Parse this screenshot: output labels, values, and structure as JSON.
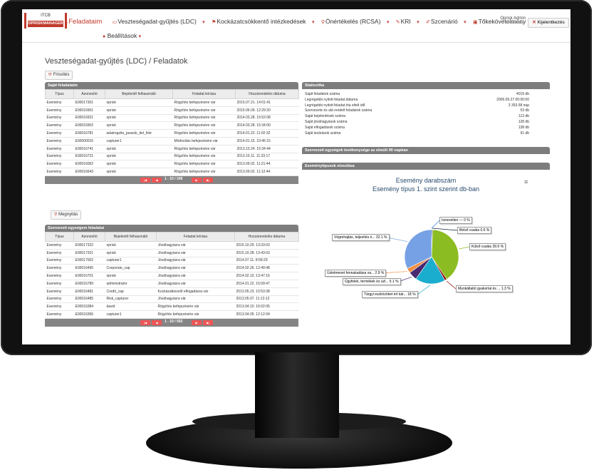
{
  "app": {
    "logo_line1": "ITCB",
    "logo_line2": "OPRISKMANAGER"
  },
  "nav": {
    "items": [
      {
        "label": "Feladataim",
        "icon": "home-icon",
        "active": true
      },
      {
        "label": "Veszteségadat-gyűjtés (LDC)",
        "icon": "folder-icon"
      },
      {
        "label": "Kockázatcsökkentő intézkedések",
        "icon": "flag-icon"
      },
      {
        "label": "Önértékelés (RCSA)",
        "icon": "marker-icon"
      },
      {
        "label": "KRI",
        "icon": "wrench-icon"
      },
      {
        "label": "Szcenárió",
        "icon": "pencil-icon"
      },
      {
        "label": "Tőkekövetelmény",
        "icon": "lock-icon"
      }
    ],
    "settings_label": "Beállítások"
  },
  "user": {
    "name": "Oprisk Admin",
    "role": "Adminisztrátor",
    "logout_label": "Kijelentkezés"
  },
  "page": {
    "title": "Veszteségadat-gyűjtés (LDC) / Feladatok",
    "refresh_label": "Frissítés",
    "open_label": "Megnyitás"
  },
  "my_tasks": {
    "title": "Saját feladataim",
    "columns": [
      "Típus",
      "Azonosító",
      "Bejelentő felhasználó",
      "Feladat leírása",
      "Hozzárendelés dátuma"
    ],
    "rows": [
      [
        "Esemény",
        "E00017301",
        "oprisk",
        "Rögzítés befejezésére vár",
        "2015.07.21. 14:01:41"
      ],
      [
        "Esemény",
        "E00016901",
        "oprisk",
        "Rögzítés befejezésére vár",
        "2015.06.09. 12:29:20"
      ],
      [
        "Esemény",
        "E00016921",
        "oprisk",
        "Rögzítés befejezésére vár",
        "2014.03.28. 15:52:08"
      ],
      [
        "Esemény",
        "E00016902",
        "oprisk",
        "Rögzítés befejezésére vár",
        "2014.03.28. 15:34:00"
      ],
      [
        "Esemény",
        "E00016781",
        "adatrogzito_javaslo_del_fele",
        "Rögzítés befejezésére vár",
        "2014.01.22. 11:02:32"
      ],
      [
        "Esemény",
        "E00000015",
        "capturer1",
        "Módosítás befejezésére vár",
        "2014.01.15. 10:45:15"
      ],
      [
        "Esemény",
        "E00016741",
        "oprisk",
        "Rögzítés befejezésére vár",
        "2013.10.24. 15:34:44"
      ],
      [
        "Esemény",
        "E00016721",
        "oprisk",
        "Rögzítés befejezésére vár",
        "2013.10.11. 11:33:17"
      ],
      [
        "Esemény",
        "E00016062",
        "oprisk",
        "Rögzítés befejezésére vár",
        "2013.09.02. 11:21:44"
      ],
      [
        "Esemény",
        "E00016643",
        "oprisk",
        "Rögzítés befejezésére vár",
        "2013.09.02. 11:12:44"
      ]
    ],
    "pager": "1 - 10 / 249"
  },
  "org_tasks": {
    "title": "Szervezeti egységem feladatai",
    "columns": [
      "Típus",
      "Azonosító",
      "Bejelentő felhasználó",
      "Feladat leírása",
      "Hozzárendelés dátuma"
    ],
    "rows": [
      [
        "Esemény",
        "E00017322",
        "oprisk",
        "Jóváhagyásra vár",
        "2015.10.29. 13:33:03"
      ],
      [
        "Esemény",
        "E00017321",
        "oprisk",
        "Jóváhagyásra vár",
        "2015.10.28. 13:43:03"
      ],
      [
        "Esemény",
        "E00017002",
        "capturer1",
        "Jóváhagyásra vár",
        "2014.07.11. 8:58:29"
      ],
      [
        "Esemény",
        "E00016495",
        "Corporate_cap",
        "Jóváhagyásra vár",
        "2014.02.26. 12:49:48"
      ],
      [
        "Esemény",
        "E00016701",
        "oprisk",
        "Jóváhagyásra vár",
        "2014.02.10. 13:47:16"
      ],
      [
        "Esemény",
        "E00016789",
        "administrator",
        "Jóváhagyásra vár",
        "2014.01.22. 15:09:47"
      ],
      [
        "Esemény",
        "E00016481",
        "Credit_cap",
        "Kockázatkezelő elfogadásra vár",
        "2013.05.23. 10:53:38"
      ],
      [
        "Esemény",
        "E00016485",
        "Risk_capturer",
        "Jóváhagyásra vár",
        "2013.05.07. 11:13:12"
      ],
      [
        "Esemény",
        "E00016384",
        "david",
        "Rögzítés befejezésére vár",
        "2013.04.10. 16:02:05"
      ],
      [
        "Esemény",
        "E00016366",
        "capturer1",
        "Rögzítés befejezésére vár",
        "2013.04.05. 12:12:04"
      ]
    ],
    "pager": "1 - 10 / 593"
  },
  "stats": {
    "title": "Statisztika",
    "rows": [
      {
        "label": "Saját feladatok száma",
        "value": "4019 db"
      },
      {
        "label": "Legrégebbi nyitott feladat dátuma",
        "value": "2006.09.27 00:00:00"
      },
      {
        "label": "Legrégebbi nyitott feladat óta eltelt idő",
        "value": "3 353.58 nap"
      },
      {
        "label": "Szervezete és alá rendelt feladatok száma",
        "value": "53 db"
      },
      {
        "label": "Saját bejelentések száma",
        "value": "113 db"
      },
      {
        "label": "Saját jóváhagyások száma",
        "value": "128 db"
      },
      {
        "label": "Saját elfogadások száma",
        "value": "138 db"
      },
      {
        "label": "Saját lezárások száma",
        "value": "91 db"
      }
    ]
  },
  "activity": {
    "title": "Szervezeti egységek tevékenysége az elmúlt 90 napban"
  },
  "event_types": {
    "title": "Eseménytípusok eloszlása"
  },
  "chart_data": {
    "type": "pie",
    "title": "Esemény darabszám",
    "subtitle": "Esemény típus 1. szint szerint db-ban",
    "series": [
      {
        "values": [
          {
            "name": "Ismeretlen —",
            "value": 0,
            "label": "Ismeretlen — 0 %",
            "color": "#2f7ed8"
          },
          {
            "name": "Belső csalás",
            "value": 0.6,
            "label": "Belső csalás 0.6 %",
            "color": "#0d233a"
          },
          {
            "name": "Külső csalás",
            "value": 39.9,
            "label": "Külső csalás 39.9 %",
            "color": "#8bbc21"
          },
          {
            "name": "Munkáltatói gyakorlat és ...",
            "value": 1.3,
            "label": "Munkáltatói gyakorlat és ... 1.3 %",
            "color": "#910000"
          },
          {
            "name": "Tárgyi eszközöket ért kár...",
            "value": 18,
            "label": "Tárgyi eszközöket ért kár... 18 %",
            "color": "#1aadce"
          },
          {
            "name": "Ügyfelek, termékek és üzl...",
            "value": 5.1,
            "label": "Ügyfelek, termékek és üzl... 5.1 %",
            "color": "#492970"
          },
          {
            "name": "Üzletmenet fennakadása va...",
            "value": 2.9,
            "label": "Üzletmenet fennakadása va... 2.9 %",
            "color": "#f28f43"
          },
          {
            "name": "Végrehajtás, teljesítés é...",
            "value": 32.1,
            "label": "Végrehajtás, teljesítés é... 32.1 %",
            "color": "#77a1e5"
          }
        ]
      }
    ]
  }
}
